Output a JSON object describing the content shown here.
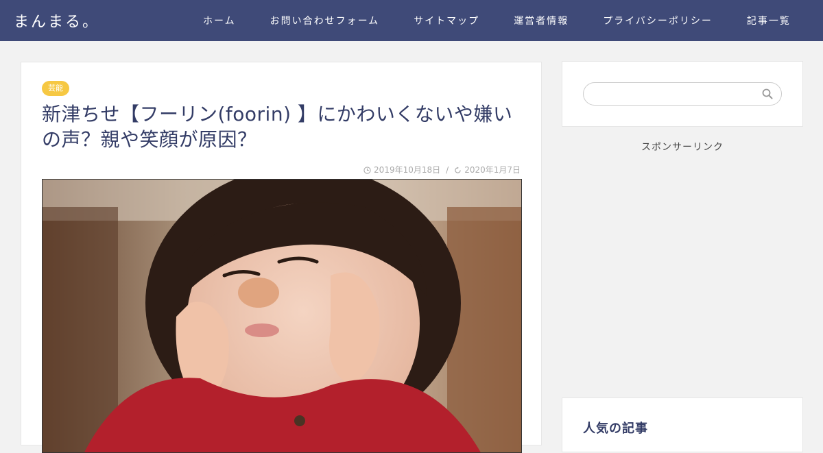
{
  "header": {
    "site_title": "まんまる。",
    "nav": [
      "ホーム",
      "お問い合わせフォーム",
      "サイトマップ",
      "運営者情報",
      "プライバシーポリシー",
      "記事一覧"
    ]
  },
  "post": {
    "category": "芸能",
    "title": "新津ちせ【フーリン(foorin) 】にかわいくないや嫌いの声？親や笑顔が原因？",
    "published": "2019年10月18日",
    "updated": "2020年1月7日"
  },
  "sidebar": {
    "search_placeholder": "",
    "sponsor_label": "スポンサーリンク",
    "popular_title": "人気の記事"
  },
  "colors": {
    "header_bg": "#3f4a78",
    "badge_bg": "#f6c843",
    "title_color": "#333c66"
  }
}
